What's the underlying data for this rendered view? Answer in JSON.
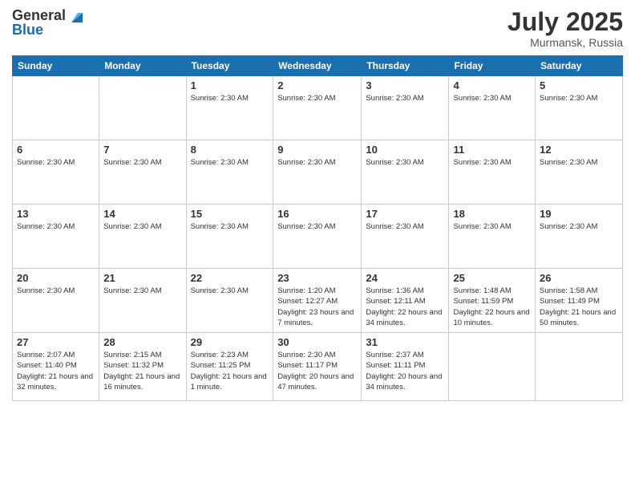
{
  "logo": {
    "line1": "General",
    "line2": "Blue"
  },
  "title": "July 2025",
  "location": "Murmansk, Russia",
  "days_of_week": [
    "Sunday",
    "Monday",
    "Tuesday",
    "Wednesday",
    "Thursday",
    "Friday",
    "Saturday"
  ],
  "weeks": [
    [
      {
        "day": "",
        "info": ""
      },
      {
        "day": "",
        "info": ""
      },
      {
        "day": "1",
        "info": "Sunrise: 2:30 AM"
      },
      {
        "day": "2",
        "info": "Sunrise: 2:30 AM"
      },
      {
        "day": "3",
        "info": "Sunrise: 2:30 AM"
      },
      {
        "day": "4",
        "info": "Sunrise: 2:30 AM"
      },
      {
        "day": "5",
        "info": "Sunrise: 2:30 AM"
      }
    ],
    [
      {
        "day": "6",
        "info": "Sunrise: 2:30 AM"
      },
      {
        "day": "7",
        "info": "Sunrise: 2:30 AM"
      },
      {
        "day": "8",
        "info": "Sunrise: 2:30 AM"
      },
      {
        "day": "9",
        "info": "Sunrise: 2:30 AM"
      },
      {
        "day": "10",
        "info": "Sunrise: 2:30 AM"
      },
      {
        "day": "11",
        "info": "Sunrise: 2:30 AM"
      },
      {
        "day": "12",
        "info": "Sunrise: 2:30 AM"
      }
    ],
    [
      {
        "day": "13",
        "info": "Sunrise: 2:30 AM"
      },
      {
        "day": "14",
        "info": "Sunrise: 2:30 AM"
      },
      {
        "day": "15",
        "info": "Sunrise: 2:30 AM"
      },
      {
        "day": "16",
        "info": "Sunrise: 2:30 AM"
      },
      {
        "day": "17",
        "info": "Sunrise: 2:30 AM"
      },
      {
        "day": "18",
        "info": "Sunrise: 2:30 AM"
      },
      {
        "day": "19",
        "info": "Sunrise: 2:30 AM"
      }
    ],
    [
      {
        "day": "20",
        "info": "Sunrise: 2:30 AM"
      },
      {
        "day": "21",
        "info": "Sunrise: 2:30 AM"
      },
      {
        "day": "22",
        "info": "Sunrise: 2:30 AM"
      },
      {
        "day": "23",
        "info": "Sunrise: 1:20 AM\nSunset: 12:27 AM\nDaylight: 23 hours and 7 minutes."
      },
      {
        "day": "24",
        "info": "Sunrise: 1:36 AM\nSunset: 12:11 AM\nDaylight: 22 hours and 34 minutes."
      },
      {
        "day": "25",
        "info": "Sunrise: 1:48 AM\nSunset: 11:59 PM\nDaylight: 22 hours and 10 minutes."
      },
      {
        "day": "26",
        "info": "Sunrise: 1:58 AM\nSunset: 11:49 PM\nDaylight: 21 hours and 50 minutes."
      }
    ],
    [
      {
        "day": "27",
        "info": "Sunrise: 2:07 AM\nSunset: 11:40 PM\nDaylight: 21 hours and 32 minutes."
      },
      {
        "day": "28",
        "info": "Sunrise: 2:15 AM\nSunset: 11:32 PM\nDaylight: 21 hours and 16 minutes."
      },
      {
        "day": "29",
        "info": "Sunrise: 2:23 AM\nSunset: 11:25 PM\nDaylight: 21 hours and 1 minute."
      },
      {
        "day": "30",
        "info": "Sunrise: 2:30 AM\nSunset: 11:17 PM\nDaylight: 20 hours and 47 minutes."
      },
      {
        "day": "31",
        "info": "Sunrise: 2:37 AM\nSunset: 11:11 PM\nDaylight: 20 hours and 34 minutes."
      },
      {
        "day": "",
        "info": ""
      },
      {
        "day": "",
        "info": ""
      }
    ]
  ]
}
